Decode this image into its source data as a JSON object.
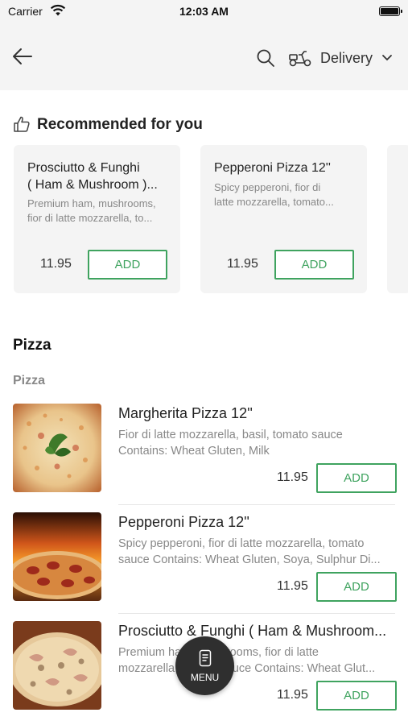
{
  "status_bar": {
    "carrier": "Carrier",
    "time": "12:03 AM"
  },
  "header": {
    "delivery_label": "Delivery"
  },
  "recommended": {
    "title": "Recommended for you",
    "cards": [
      {
        "name_line1": "Prosciutto & Funghi",
        "name_line2": "( Ham & Mushroom )...",
        "desc_line1": "Premium ham, mushrooms,",
        "desc_line2": "fior di latte mozzarella, to...",
        "price": "11.95",
        "add_label": "ADD"
      },
      {
        "name_line1": "Pepperoni Pizza 12''",
        "desc_line1": "Spicy pepperoni, fior di",
        "desc_line2": "latte mozzarella, tomato...",
        "price": "11.95",
        "add_label": "ADD"
      }
    ]
  },
  "section": {
    "title": "Pizza",
    "subtitle": "Pizza"
  },
  "items": [
    {
      "name": "Margherita Pizza 12''",
      "desc_line1": "Fior di latte mozzarella, basil, tomato sauce",
      "desc_line2": "Contains: Wheat Gluten, Milk",
      "price": "11.95",
      "add_label": "ADD"
    },
    {
      "name": "Pepperoni Pizza 12''",
      "desc_line1": "Spicy pepperoni, fior di latte mozzarella, tomato",
      "desc_line2": "sauce Contains: Wheat Gluten, Soya, Sulphur Di...",
      "price": "11.95",
      "add_label": "ADD"
    },
    {
      "name": "Prosciutto & Funghi ( Ham & Mushroom...",
      "desc_line1": "Premium ham, mushrooms, fior di latte",
      "desc_line2": "mozzarella, tomato sauce Contains: Wheat Glut...",
      "price": "11.95",
      "add_label": "ADD"
    }
  ],
  "menu_button": {
    "label": "MENU"
  },
  "colors": {
    "accent": "#3fa35f",
    "header_bg": "#f4f4f4",
    "fab_bg": "#2f2f2f"
  }
}
